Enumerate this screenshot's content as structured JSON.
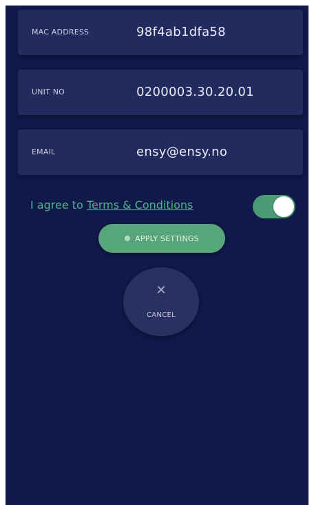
{
  "fields": {
    "mac": {
      "label": "MAC ADDRESS",
      "value": "98f4ab1dfa58"
    },
    "unit": {
      "label": "UNIT NO",
      "value": "0200003.30.20.01"
    },
    "email": {
      "label": "EMAIL",
      "value": "ensy@ensy.no"
    }
  },
  "terms": {
    "prefix": "I agree to ",
    "link": "Terms & Conditions",
    "toggle_on": true
  },
  "actions": {
    "apply_label": "APPLY SETTINGS",
    "cancel_icon": "close-icon",
    "cancel_symbol": "✕",
    "cancel_label": "CANCEL"
  },
  "colors": {
    "background": "#11184a",
    "card": "#232a5e",
    "accent_green": "#57a67b",
    "text_green": "#4fb48b"
  }
}
